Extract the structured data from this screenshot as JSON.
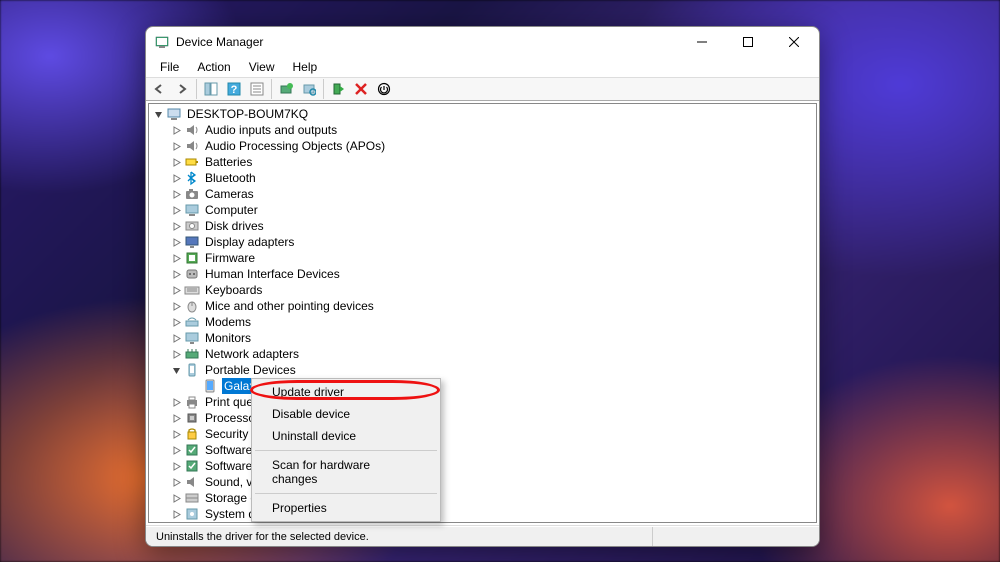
{
  "window": {
    "title": "Device Manager"
  },
  "menu": {
    "items": [
      "File",
      "Action",
      "View",
      "Help"
    ]
  },
  "tree": {
    "root": "DESKTOP-BOUM7KQ",
    "nodes": [
      {
        "label": "Audio inputs and outputs",
        "icon": "speaker"
      },
      {
        "label": "Audio Processing Objects (APOs)",
        "icon": "speaker"
      },
      {
        "label": "Batteries",
        "icon": "battery"
      },
      {
        "label": "Bluetooth",
        "icon": "bluetooth"
      },
      {
        "label": "Cameras",
        "icon": "camera"
      },
      {
        "label": "Computer",
        "icon": "computer"
      },
      {
        "label": "Disk drives",
        "icon": "disk"
      },
      {
        "label": "Display adapters",
        "icon": "display"
      },
      {
        "label": "Firmware",
        "icon": "firmware"
      },
      {
        "label": "Human Interface Devices",
        "icon": "hid"
      },
      {
        "label": "Keyboards",
        "icon": "keyboard"
      },
      {
        "label": "Mice and other pointing devices",
        "icon": "mouse"
      },
      {
        "label": "Modems",
        "icon": "modem"
      },
      {
        "label": "Monitors",
        "icon": "monitor"
      },
      {
        "label": "Network adapters",
        "icon": "network"
      },
      {
        "label": "Portable Devices",
        "icon": "portable",
        "expanded": true,
        "children": [
          {
            "label": "Galaxy A34",
            "icon": "device",
            "selected": true
          }
        ]
      },
      {
        "label": "Print queues",
        "icon": "printer",
        "truncated": "Print que"
      },
      {
        "label": "Processors",
        "icon": "cpu",
        "truncated": "Processor"
      },
      {
        "label": "Security devices",
        "icon": "security",
        "truncated": "Security c"
      },
      {
        "label": "Software components",
        "icon": "software",
        "truncated": "Software"
      },
      {
        "label": "Software devices",
        "icon": "software",
        "truncated": "Software"
      },
      {
        "label": "Sound, video and game controllers",
        "icon": "sound",
        "truncated": "Sound, vi"
      },
      {
        "label": "Storage controllers",
        "icon": "storage",
        "truncated": "Storage c"
      },
      {
        "label": "System devices",
        "icon": "system",
        "truncated": "System devices"
      }
    ]
  },
  "context_menu": {
    "items": [
      {
        "label": "Update driver"
      },
      {
        "label": "Disable device"
      },
      {
        "label": "Uninstall device"
      },
      {
        "sep": true
      },
      {
        "label": "Scan for hardware changes"
      },
      {
        "sep": true
      },
      {
        "label": "Properties"
      }
    ]
  },
  "statusbar": {
    "text": "Uninstalls the driver for the selected device."
  }
}
